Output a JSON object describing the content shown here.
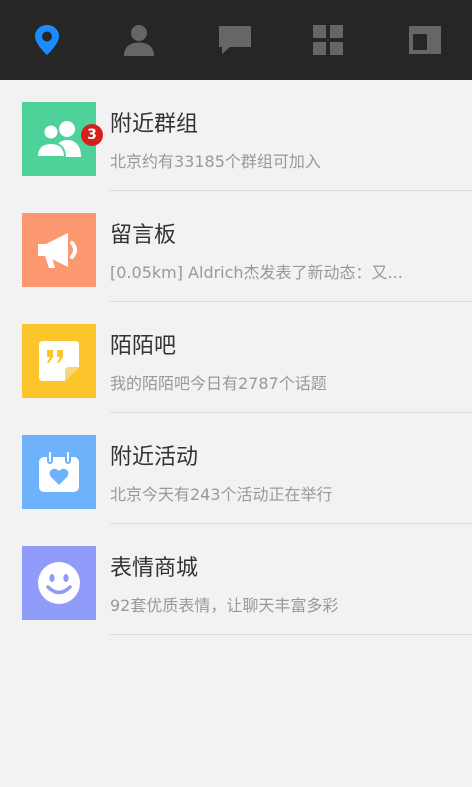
{
  "topbar": {
    "tabs": [
      {
        "icon": "location-pin-icon",
        "active": true
      },
      {
        "icon": "person-icon",
        "active": false
      },
      {
        "icon": "chat-bubble-icon",
        "active": false
      },
      {
        "icon": "grid-icon",
        "active": false
      },
      {
        "icon": "browser-window-icon",
        "active": false
      }
    ],
    "active_color": "#1a8cff",
    "inactive_color": "#666666"
  },
  "items": [
    {
      "title": "附近群组",
      "subtitle": "北京约有33185个群组可加入",
      "icon": "group-icon",
      "color": "#4fd19a"
    },
    {
      "title": "留言板",
      "subtitle": "[0.05km] Aldrich杰发表了新动态：又...",
      "icon": "megaphone-icon",
      "color": "#fc9870",
      "badge": "3"
    },
    {
      "title": "陌陌吧",
      "subtitle": "我的陌陌吧今日有2787个话题",
      "icon": "quote-note-icon",
      "color": "#fdc52c"
    },
    {
      "title": "附近活动",
      "subtitle": "北京今天有243个活动正在举行",
      "icon": "calendar-heart-icon",
      "color": "#6fb2fc"
    },
    {
      "title": "表情商城",
      "subtitle": "92套优质表情，让聊天丰富多彩",
      "icon": "smiley-icon",
      "color": "#8f9cf9"
    }
  ]
}
